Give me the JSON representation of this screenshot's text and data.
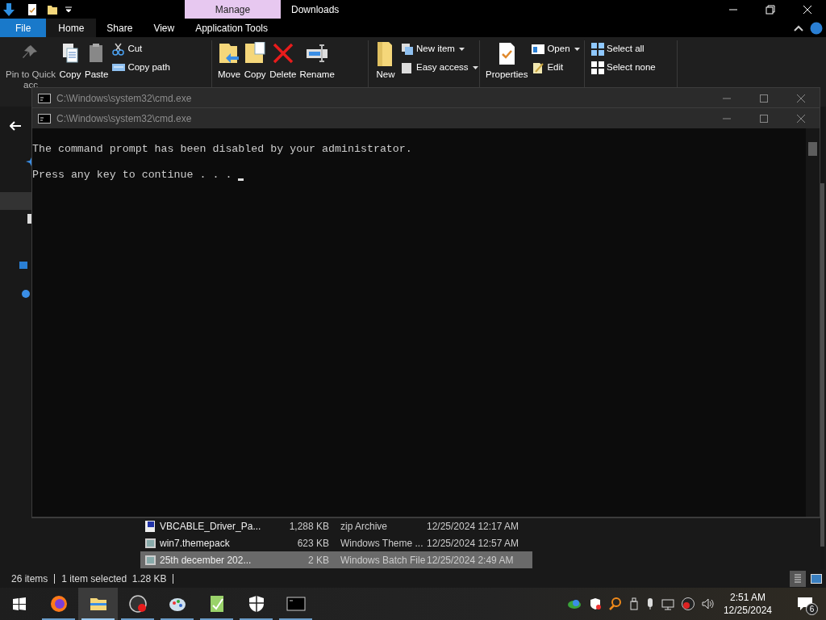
{
  "explorer": {
    "context_tab": "Manage",
    "title": "Downloads",
    "tabs": [
      {
        "label": "File",
        "kind": "file",
        "selected": false
      },
      {
        "label": "Home",
        "kind": "tab",
        "selected": true
      },
      {
        "label": "Share",
        "kind": "tab",
        "selected": false
      },
      {
        "label": "View",
        "kind": "tab",
        "selected": false
      },
      {
        "label": "Application Tools",
        "kind": "tab",
        "selected": false
      }
    ],
    "ribbon_groups": [
      {
        "items": [
          {
            "kind": "large",
            "label": "Pin to Quick",
            "label_2": "acc",
            "disabled": true
          },
          {
            "kind": "large",
            "label": "Copy",
            "disabled": false
          },
          {
            "kind": "large",
            "label": "Paste",
            "disabled": false
          },
          {
            "kind": "small",
            "label": "Cut",
            "disabled": false
          },
          {
            "kind": "small",
            "label": "Copy path",
            "disabled": false
          }
        ]
      },
      {
        "items": [
          {
            "kind": "large",
            "label": "Move",
            "disabled": false
          },
          {
            "kind": "large",
            "label": "Copy",
            "disabled": false
          },
          {
            "kind": "large",
            "label": "Delete",
            "disabled": false
          },
          {
            "kind": "large",
            "label": "Rename",
            "disabled": false
          }
        ]
      },
      {
        "items": [
          {
            "kind": "large",
            "label": "New",
            "disabled": false
          },
          {
            "kind": "small",
            "label": "New item",
            "dropdown": true,
            "disabled": false
          },
          {
            "kind": "small",
            "label": "Easy access",
            "dropdown": true,
            "disabled": false
          }
        ]
      },
      {
        "items": [
          {
            "kind": "large",
            "label": "Properties",
            "disabled": false
          },
          {
            "kind": "small",
            "label": "Open",
            "dropdown": true,
            "disabled": false
          },
          {
            "kind": "small",
            "label": "Edit",
            "disabled": false
          }
        ]
      },
      {
        "items": [
          {
            "kind": "small",
            "label": "Select all",
            "disabled": false
          },
          {
            "kind": "small",
            "label": "Select none",
            "disabled": false
          }
        ]
      }
    ],
    "files": [
      {
        "name": "VBCABLE_Driver_Pa...",
        "size": "1,288 KB",
        "type": "zip Archive",
        "modified": "12/25/2024 12:17 AM",
        "selected": false
      },
      {
        "name": "win7.themepack",
        "size": "623 KB",
        "type": "Windows Theme ...",
        "modified": "12/25/2024 12:57 AM",
        "selected": false
      },
      {
        "name": "25th december 202...",
        "size": "2 KB",
        "type": "Windows Batch File",
        "modified": "12/25/2024 2:49 AM",
        "selected": true
      }
    ],
    "status_bar": {
      "count": "26 items",
      "selection": "1 item selected  1.28 KB"
    }
  },
  "cmd_windows": [
    {
      "title": "C:\\Windows\\system32\\cmd.exe"
    },
    {
      "title": "C:\\Windows\\system32\\cmd.exe",
      "lines": [
        "The command prompt has been disabled by your administrator.",
        "Press any key to continue . . . "
      ]
    }
  ],
  "taskbar": {
    "apps": [
      {
        "kind": "firefox",
        "active": false
      },
      {
        "kind": "explorer",
        "active": true
      },
      {
        "kind": "recorder",
        "active": false
      },
      {
        "kind": "paint",
        "active": false
      },
      {
        "kind": "notepad",
        "active": false
      },
      {
        "kind": "shield",
        "active": false
      },
      {
        "kind": "terminal",
        "active": false
      }
    ],
    "time": "2:51 AM",
    "date": "12/25/2024",
    "notifications": "6"
  }
}
